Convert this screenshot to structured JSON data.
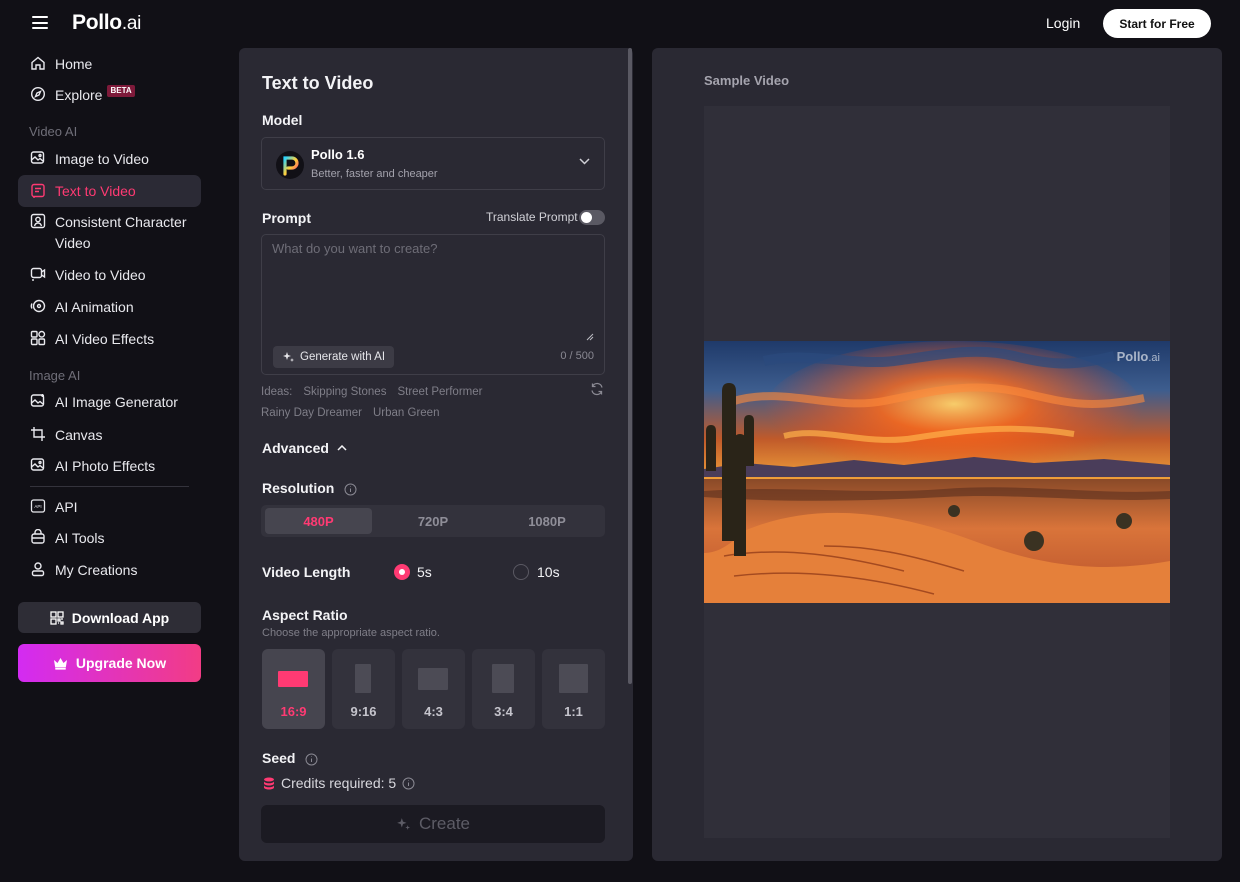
{
  "header": {
    "logo_main": "Pollo",
    "logo_suffix": ".ai",
    "login_label": "Login",
    "start_label": "Start for Free"
  },
  "sidebar": {
    "home": "Home",
    "explore": "Explore",
    "explore_badge": "BETA",
    "section_video": "Video AI",
    "image_to_video": "Image to Video",
    "text_to_video": "Text to Video",
    "consistent_character": "Consistent Character",
    "consistent_character_line2": "Video",
    "video_to_video": "Video to Video",
    "ai_animation": "AI Animation",
    "ai_video_effects": "AI Video Effects",
    "section_image": "Image AI",
    "ai_image_generator": "AI Image Generator",
    "canvas": "Canvas",
    "ai_photo_effects": "AI Photo Effects",
    "api": "API",
    "ai_tools": "AI Tools",
    "my_creations": "My Creations",
    "download_app": "Download App",
    "upgrade_now": "Upgrade Now"
  },
  "form": {
    "title": "Text to Video",
    "model_label": "Model",
    "model_name": "Pollo 1.6",
    "model_desc": "Better, faster and cheaper",
    "prompt_label": "Prompt",
    "translate_label": "Translate Prompt",
    "translate_on": false,
    "prompt_placeholder": "What do you want to create?",
    "prompt_value": "",
    "generate_ai_label": "Generate with AI",
    "char_count": "0 / 500",
    "ideas_label": "Ideas:",
    "ideas": [
      "Skipping Stones",
      "Street Performer",
      "Rainy Day Dreamer",
      "Urban Green"
    ],
    "advanced_label": "Advanced",
    "resolution_label": "Resolution",
    "resolutions": [
      "480P",
      "720P",
      "1080P"
    ],
    "resolution_selected": "480P",
    "video_length_label": "Video Length",
    "lengths": [
      "5s",
      "10s"
    ],
    "length_selected": "5s",
    "aspect_ratio_label": "Aspect Ratio",
    "aspect_ratio_sub": "Choose the appropriate aspect ratio.",
    "aspect_ratios": [
      "16:9",
      "9:16",
      "4:3",
      "3:4",
      "1:1"
    ],
    "aspect_selected": "16:9",
    "seed_label": "Seed",
    "credits_label": "Credits required: 5",
    "create_label": "Create"
  },
  "preview": {
    "sample_label": "Sample Video",
    "watermark_main": "Pollo",
    "watermark_suffix": ".ai"
  },
  "colors": {
    "accent": "#ff3a73",
    "panel": "#2a2933",
    "background": "#111016",
    "upgrade_gradient_start": "#d32bf2",
    "upgrade_gradient_end": "#f23c85"
  }
}
